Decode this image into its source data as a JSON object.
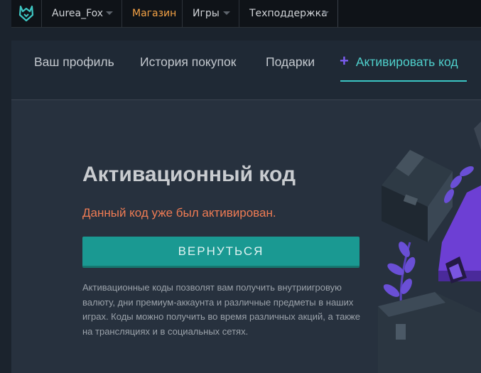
{
  "topbar": {
    "logo_icon": "fox-logo-icon",
    "user": "Aurea_Fox",
    "shop": "Магазин",
    "games": "Игры",
    "support": "Техподдержка",
    "accent_color": "#f4a245"
  },
  "tabs": [
    {
      "label": "Ваш профиль"
    },
    {
      "label": "История покупок"
    },
    {
      "label": "Подарки"
    },
    {
      "label": "Активировать код",
      "icon": "plus-icon",
      "active": true
    }
  ],
  "main": {
    "title": "Активационный код",
    "error": "Данный код уже был активирован.",
    "back_label": "ВЕРНУТЬСЯ",
    "description": "Активационные коды позволят вам получить внутриигровую валюту, дни премиум-аккаунта и различные предметы в наших играх. Коды можно получить во время различных акций, а также на трансляциях и в социальных сетях."
  },
  "colors": {
    "active_tab": "#4fd0cc",
    "button": "#1a9992",
    "error": "#f07c54",
    "plus": "#7b5cf0"
  }
}
